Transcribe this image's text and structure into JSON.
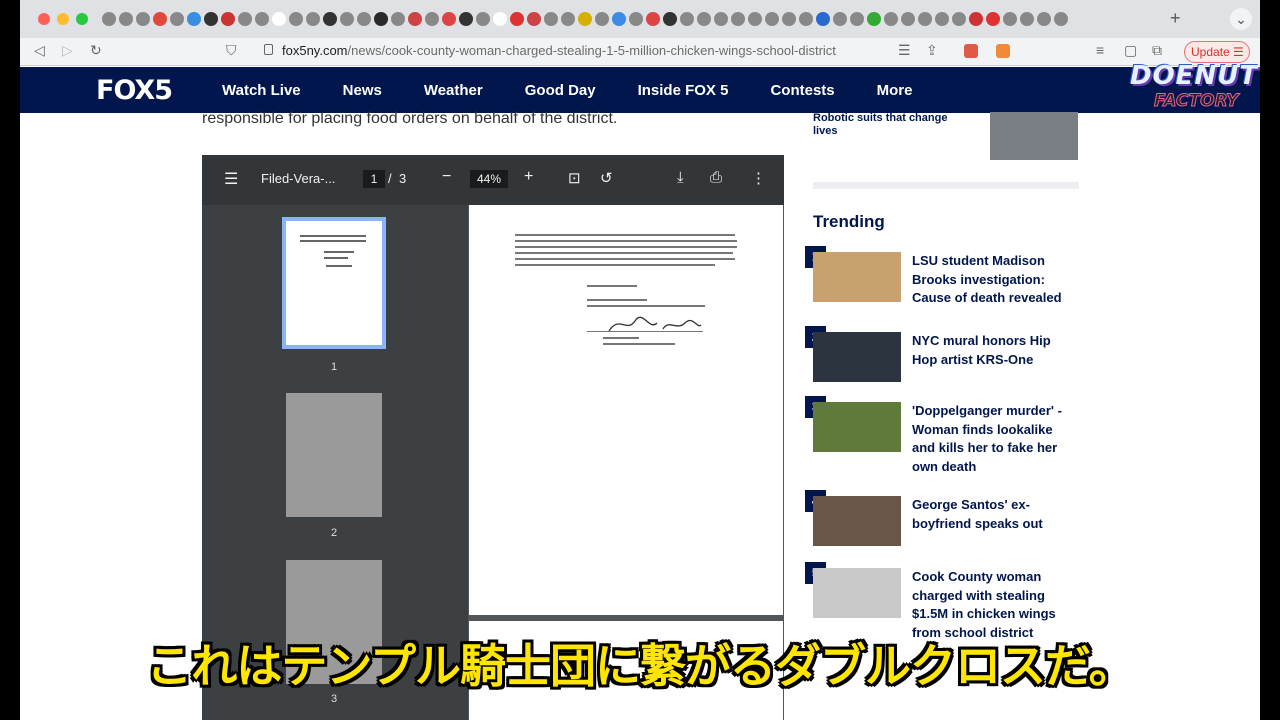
{
  "browser": {
    "url_domain": "fox5ny.com",
    "url_path": "/news/cook-county-woman-charged-stealing-1-5-million-chicken-wings-school-district",
    "new_tab": "+",
    "update_label": "Update"
  },
  "site": {
    "logo": "FOX5",
    "nav": [
      "Watch Live",
      "News",
      "Weather",
      "Good Day",
      "Inside FOX 5",
      "Contests",
      "More"
    ]
  },
  "watermark": {
    "top": "DOENUT",
    "bottom": "FACTORY"
  },
  "article": {
    "line": "responsible for placing food orders on behalf of the district."
  },
  "pdf": {
    "filename": "Filed-Vera-...",
    "page_current": "1",
    "page_sep": "/",
    "page_total": "3",
    "zoom": "44%",
    "thumb_numbers": [
      "1",
      "2",
      "3"
    ]
  },
  "rail": {
    "top_item": "Robotic suits that change lives",
    "trending_title": "Trending",
    "trending": [
      {
        "num": "1",
        "text": "LSU student Madison Brooks investigation: Cause of death revealed"
      },
      {
        "num": "2",
        "text": "NYC mural honors Hip Hop artist KRS-One"
      },
      {
        "num": "3",
        "text": "'Doppelganger murder' - Woman finds lookalike and kills her to fake her own death"
      },
      {
        "num": "4",
        "text": "George Santos' ex-boyfriend speaks out"
      },
      {
        "num": "5",
        "text": "Cook County woman charged with stealing $1.5M in chicken wings from school district"
      }
    ]
  },
  "subtitle": "これはテンプル騎士団に繋がるダブルクロスだ。"
}
